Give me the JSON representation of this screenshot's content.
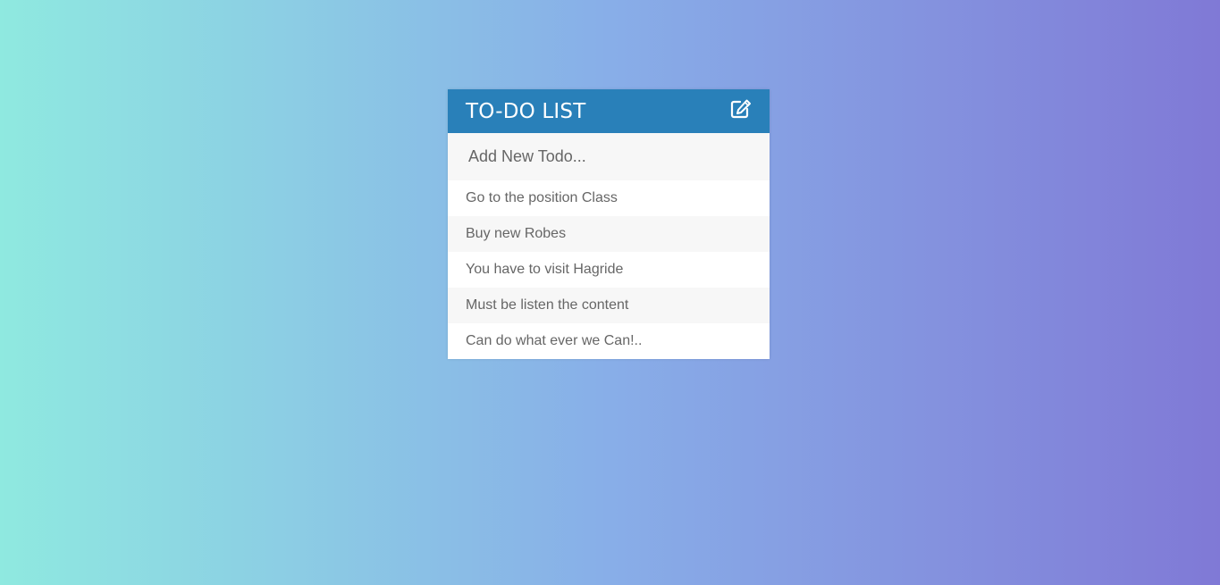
{
  "app": {
    "title": "TO-DO LIST",
    "edit_icon": "edit-icon"
  },
  "input": {
    "placeholder": "Add New Todo...",
    "value": ""
  },
  "todos": [
    {
      "text": "Go to the position Class"
    },
    {
      "text": "Buy new Robes"
    },
    {
      "text": "You have to visit Hagride"
    },
    {
      "text": "Must be listen the content"
    },
    {
      "text": "Can do what ever we Can!.."
    }
  ],
  "colors": {
    "header": "#2980b9",
    "gradient_start": "#8fe9e0",
    "gradient_end": "#8079d6",
    "text": "#666666",
    "alt_row": "#f7f7f7"
  }
}
